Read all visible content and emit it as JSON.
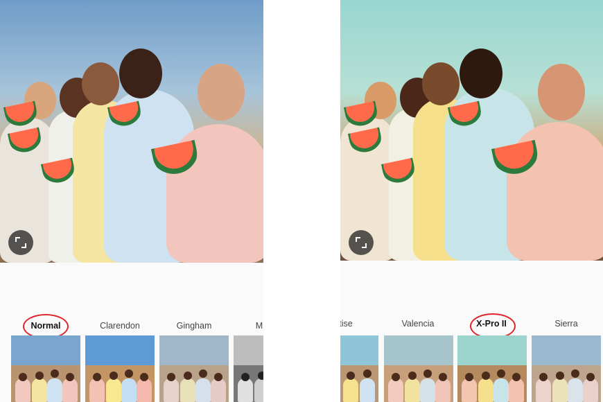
{
  "left_panel": {
    "filter_labels": [
      "Normal",
      "Clarendon",
      "Gingham",
      "M"
    ],
    "selected_filter": "Normal"
  },
  "right_panel": {
    "filter_labels": [
      "tise",
      "Valencia",
      "X-Pro II",
      "Sierra"
    ],
    "selected_filter": "X-Pro II"
  },
  "colors": {
    "highlight_ring": "#e0242b"
  },
  "icons": {
    "expand": "expand-icon"
  }
}
